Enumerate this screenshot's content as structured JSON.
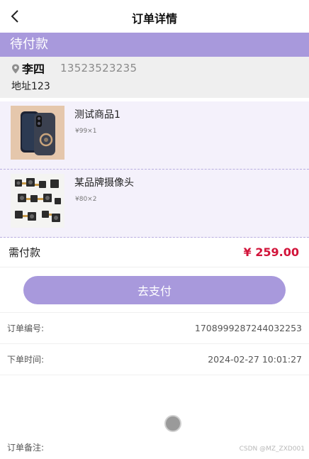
{
  "header": {
    "title": "订单详情",
    "back_icon": "chevron-left-icon"
  },
  "status": {
    "label": "待付款",
    "color": "#a899dc"
  },
  "address": {
    "name": "李四",
    "phone": "13523523235",
    "detail": "地址123",
    "icon": "location-pin-icon"
  },
  "goods": [
    {
      "name": "测试商品1",
      "price_qty": "¥99×1",
      "image": "phone-case-image"
    },
    {
      "name": "某品牌摄像头",
      "price_qty": "¥80×2",
      "image": "camera-modules-image"
    }
  ],
  "total": {
    "label": "需付款",
    "amount": "¥ 259.00",
    "color": "#d2143a"
  },
  "pay_button": {
    "label": "去支付"
  },
  "info": {
    "order_no_label": "订单编号:",
    "order_no": "1708999287244032253",
    "order_time_label": "下单时间:",
    "order_time": "2024-02-27 10:01:27",
    "remark_label": "订单备注:"
  },
  "watermark": "CSDN @MZ_ZXD001"
}
